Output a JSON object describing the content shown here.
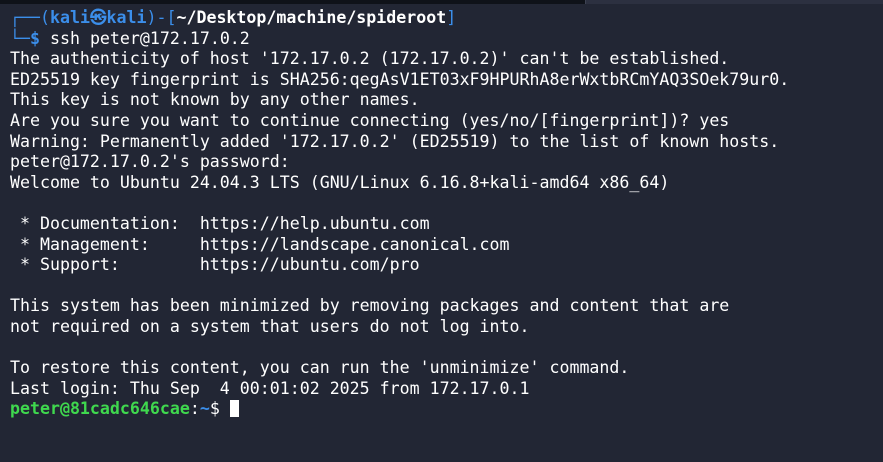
{
  "prompt_header": {
    "corner": "┌──(",
    "user": "kali",
    "at": "㉿",
    "host": "kali",
    "mid": ")-[",
    "path": "~/Desktop/machine/spideroot",
    "end": "]"
  },
  "prompt_cmd": {
    "corner": "└─",
    "dollar": "$",
    "command": "ssh peter@172.17.0.2"
  },
  "output_lines": [
    "The authenticity of host '172.17.0.2 (172.17.0.2)' can't be established.",
    "ED25519 key fingerprint is SHA256:qegAsV1ET03xF9HPURhA8erWxtbRCmYAQ3SOek79ur0.",
    "This key is not known by any other names.",
    "Are you sure you want to continue connecting (yes/no/[fingerprint])? yes",
    "Warning: Permanently added '172.17.0.2' (ED25519) to the list of known hosts.",
    "peter@172.17.0.2's password: ",
    "Welcome to Ubuntu 24.04.3 LTS (GNU/Linux 6.16.8+kali-amd64 x86_64)",
    "",
    " * Documentation:  https://help.ubuntu.com",
    " * Management:     https://landscape.canonical.com",
    " * Support:        https://ubuntu.com/pro",
    "",
    "This system has been minimized by removing packages and content that are",
    "not required on a system that users do not log into.",
    "",
    "To restore this content, you can run the 'unminimize' command.",
    "Last login: Thu Sep  4 00:01:02 2025 from 172.17.0.1"
  ],
  "remote_prompt": {
    "userhost": "peter@81cadc646cae",
    "colon": ":",
    "path": "~",
    "dollar": "$ "
  },
  "colors": {
    "background": "#222634",
    "prompt_blue": "#3b8eea",
    "remote_green": "#3fd84e"
  }
}
